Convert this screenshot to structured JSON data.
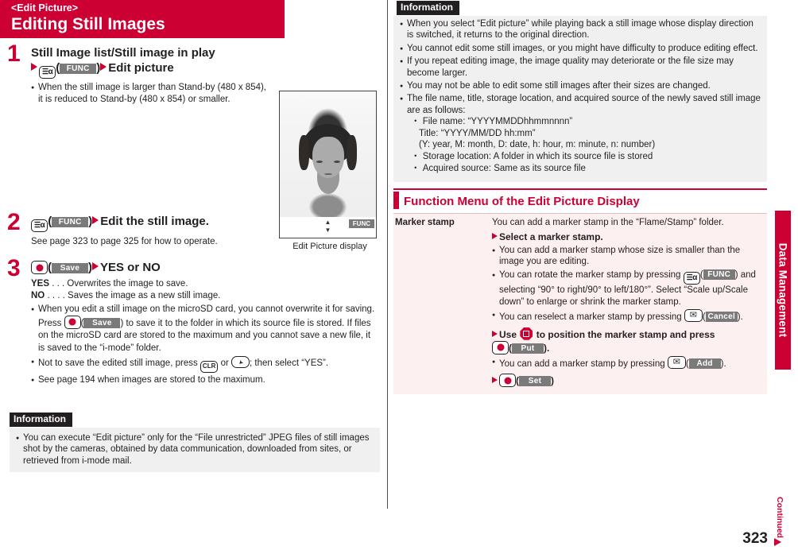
{
  "header": {
    "subtitle": "<Edit Picture>",
    "title": "Editing Still Images",
    "accent_color": "#cc0033"
  },
  "screenshot": {
    "caption": "Edit Picture display",
    "softkey_right": "FUNC"
  },
  "steps": [
    {
      "number": "1",
      "head_line1": "Still Image list/Still image in play",
      "head_key_label": "FUNC",
      "head_line2_tail": "Edit picture",
      "notes": [
        "When the still image is larger than Stand-by (480 x 854), it is reduced to Stand-by (480 x 854) or smaller."
      ]
    },
    {
      "number": "2",
      "head_key_label": "FUNC",
      "head_tail": "Edit the still image.",
      "body": "See page 323 to page 325 for how to operate."
    },
    {
      "number": "3",
      "head_key_label": "Save",
      "head_tail": "YES or NO",
      "def_yes_term": "YES",
      "def_yes_dots": ". . .",
      "def_yes_text": "Overwrites the image to save.",
      "def_no_term": "NO",
      "def_no_dots": ". . . .",
      "def_no_text": "Saves the image as a new still image.",
      "notes": [
        "When you edit a still image on the microSD card, you cannot overwrite it for saving.",
        "Not to save the edited still image, press",
        "See page 194 when images are stored to the maximum."
      ],
      "press_line_a": "Press",
      "press_key_label": "Save",
      "press_line_b": ") to save it to the folder in which its source file is stored. If files on the microSD card are stored to the maximum and you cannot save a new file, it is saved to the “i-mode” folder.",
      "clr_key": "CLR",
      "clr_tail": "; then select “YES”.",
      "clr_or": "or"
    }
  ],
  "information_left": {
    "title": "Information",
    "items": [
      "You can execute “Edit picture” only for the “File unrestricted” JPEG files of still images shot by the cameras, obtained by data communication, downloaded from sites, or retrieved from i-mode mail."
    ]
  },
  "information_right": {
    "title": "Information",
    "items": [
      "When you select “Edit picture” while playing back a still image whose display direction is switched, it returns to the original direction.",
      "You cannot edit some still images, or you might have difficulty to produce editing effect.",
      "If you repeat editing image, the image quality may deteriorate or the file size may become larger.",
      "You may not be able to edit some still images after their sizes are changed.",
      "The file name, title, storage location, and acquired source of the newly saved still image are as follows:"
    ],
    "sub_items": [
      "File name: “YYYYMMDDhhmmnnnn”",
      "Title: “YYYY/MM/DD hh:mm”",
      "(Y: year, M: month, D: date, h: hour, m: minute, n: number)",
      "Storage location: A folder in which its source file is stored",
      "Acquired source: Same as its source file"
    ],
    "sub_item_bullets": [
      "・",
      "",
      "",
      "・",
      "・"
    ]
  },
  "function_menu": {
    "section_title": "Function Menu of the Edit Picture Display",
    "rows": [
      {
        "key": "Marker stamp",
        "intro": "You can add a marker stamp in the “Flame/Stamp” folder.",
        "action1": "Select a marker stamp.",
        "notes": [
          "You can add a marker stamp whose size is smaller than the image you are editing.",
          "You can rotate the marker stamp by pressing",
          "You can reselect a marker stamp by pressing",
          "You can add a marker stamp by pressing"
        ],
        "rotate_key_label": "FUNC",
        "rotate_tail": "and selecting “90° to right/90° to left/180°”. Select “Scale up/Scale down” to enlarge or shrink the marker stamp.",
        "cancel_key_label": "Cancel",
        "action2_pre": "Use",
        "action2_mid": "to position the marker stamp and press",
        "put_key_label": "Put",
        "add_key_label": "Add",
        "set_key_label": "Set"
      }
    ]
  },
  "side_tab": {
    "label": "Data Management"
  },
  "footer": {
    "page_number": "323",
    "continued": "Continued"
  }
}
